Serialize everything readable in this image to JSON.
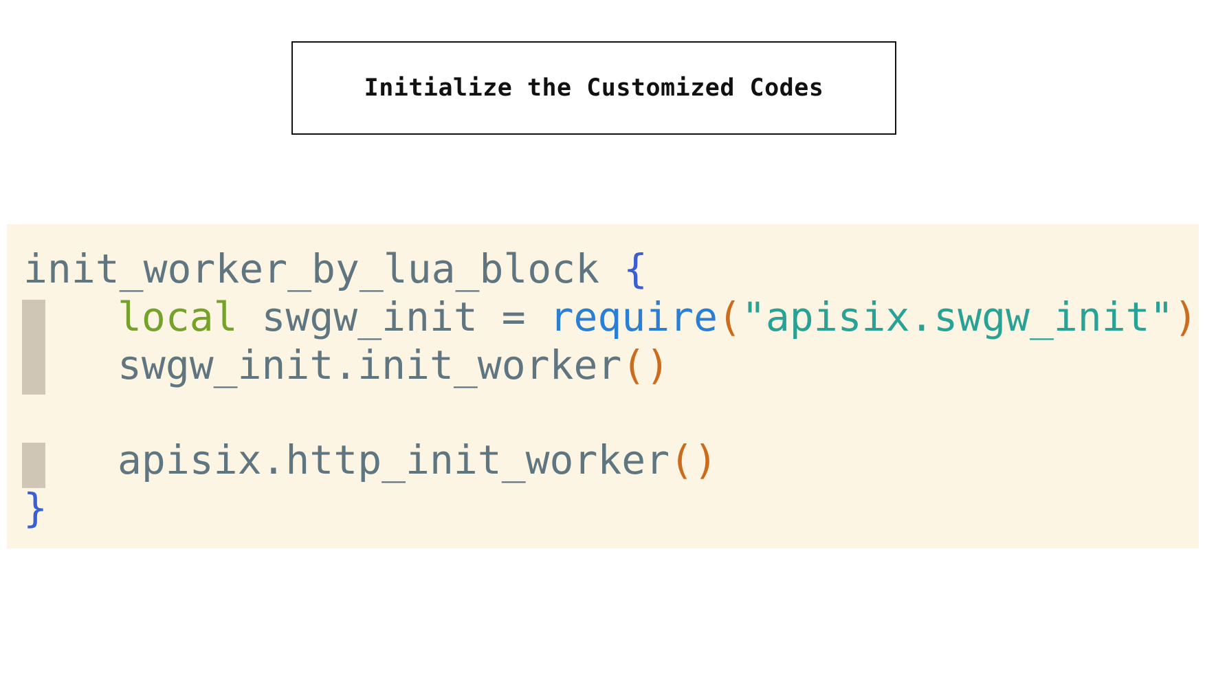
{
  "title": "Initialize the Customized Codes",
  "code": {
    "line1": {
      "directive": "init_worker_by_lua_block",
      "open_brace": "{"
    },
    "line2": {
      "keyword": "local",
      "variable": "swgw_init",
      "operator": "=",
      "function": "require",
      "open_paren": "(",
      "string": "\"apisix.swgw_init\"",
      "close_paren": ")"
    },
    "line3": {
      "call": "swgw_init.init_worker",
      "parens": "()"
    },
    "line5": {
      "call": "apisix.http_init_worker",
      "parens": "()"
    },
    "line6": {
      "close_brace": "}"
    }
  },
  "colors": {
    "directive": "#5f7580",
    "brace": "#3b5fd1",
    "keyword_local": "#76a12a",
    "function_require": "#2a7fd4",
    "paren": "#cc6b1b",
    "string": "#2aa195",
    "code_background": "#fcf5e3",
    "indent_bar": "#cfc6b5"
  }
}
